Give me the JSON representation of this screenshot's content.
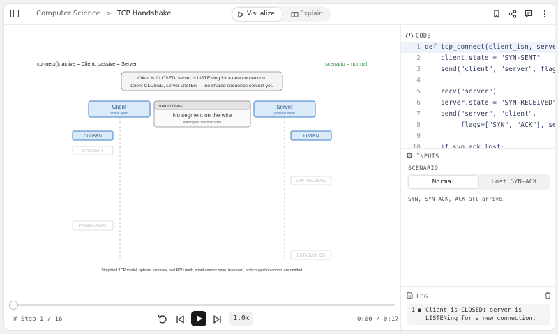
{
  "breadcrumb": {
    "section": "Computer Science",
    "separator": ">",
    "page": "TCP Handshake"
  },
  "modes": {
    "visualize": "Visualize",
    "explain": "Explain",
    "active": "visualize"
  },
  "header_icons": [
    "bookmark-icon",
    "share-icon",
    "comment-icon",
    "more-vertical-icon"
  ],
  "diagram": {
    "caption": "connect():  active = Client,  passive = Server",
    "scenario_label": "scenario = normal",
    "status_line1": "Client is CLOSED; server is LISTENing for a new connection.",
    "status_line2": "Client CLOSED, server LISTEN — no shared sequence context yet.",
    "client": {
      "title": "Client",
      "sub": "active open"
    },
    "server": {
      "title": "Server",
      "sub": "passive open"
    },
    "lens": {
      "title": "protocol lens",
      "main": "No segment on the wire",
      "sub": "Waiting for the first SYN."
    },
    "client_states": [
      {
        "label": "CLOSED",
        "active": true
      },
      {
        "label": "SYN-SENT",
        "active": false
      },
      {
        "label": "ESTABLISHED",
        "active": false
      }
    ],
    "server_states": [
      {
        "label": "LISTEN",
        "active": true
      },
      {
        "label": "SYN-RECEIVED",
        "active": false
      },
      {
        "label": "ESTABLISHED",
        "active": false
      }
    ],
    "footnote": "Simplified TCP model; options, windows, real RTO math, simultaneous open, teardown, and congestion control are omitted."
  },
  "player": {
    "step": "# Step 1 / 16",
    "speed": "1.0x",
    "time": "0:00 / 0:17",
    "progress": 0
  },
  "code": {
    "title": "CODE",
    "lines": [
      {
        "n": "1",
        "text": "def tcp_connect(client_isn, server"
      },
      {
        "n": "2",
        "text": "    client.state = \"SYN-SENT\""
      },
      {
        "n": "3",
        "text": "    send(\"client\", \"server\", flags"
      },
      {
        "n": "4",
        "text": ""
      },
      {
        "n": "5",
        "text": "    recv(\"server\")"
      },
      {
        "n": "6",
        "text": "    server.state = \"SYN-RECEIVED\""
      },
      {
        "n": "7",
        "text": "    send(\"server\", \"client\","
      },
      {
        "n": "8",
        "text": "         flags=[\"SYN\", \"ACK\"], seq"
      },
      {
        "n": "9",
        "text": ""
      },
      {
        "n": "10",
        "text": "    if syn_ack_lost:"
      }
    ]
  },
  "inputs": {
    "title": "INPUTS",
    "scenario_label": "SCENARIO",
    "options": [
      "Normal",
      "Lost SYN-ACK"
    ],
    "selected": "Normal",
    "description": "SYN, SYN-ACK, ACK all arrive."
  },
  "log": {
    "title": "LOG",
    "entries": [
      {
        "n": "1",
        "text_line1": "Client is CLOSED; server is",
        "text_line2": "LISTENing for a new connection."
      }
    ]
  },
  "colors": {
    "active_fill": "#dbeaf9",
    "active_stroke": "#3f7fc6",
    "accent_green": "#2d8a3e"
  }
}
